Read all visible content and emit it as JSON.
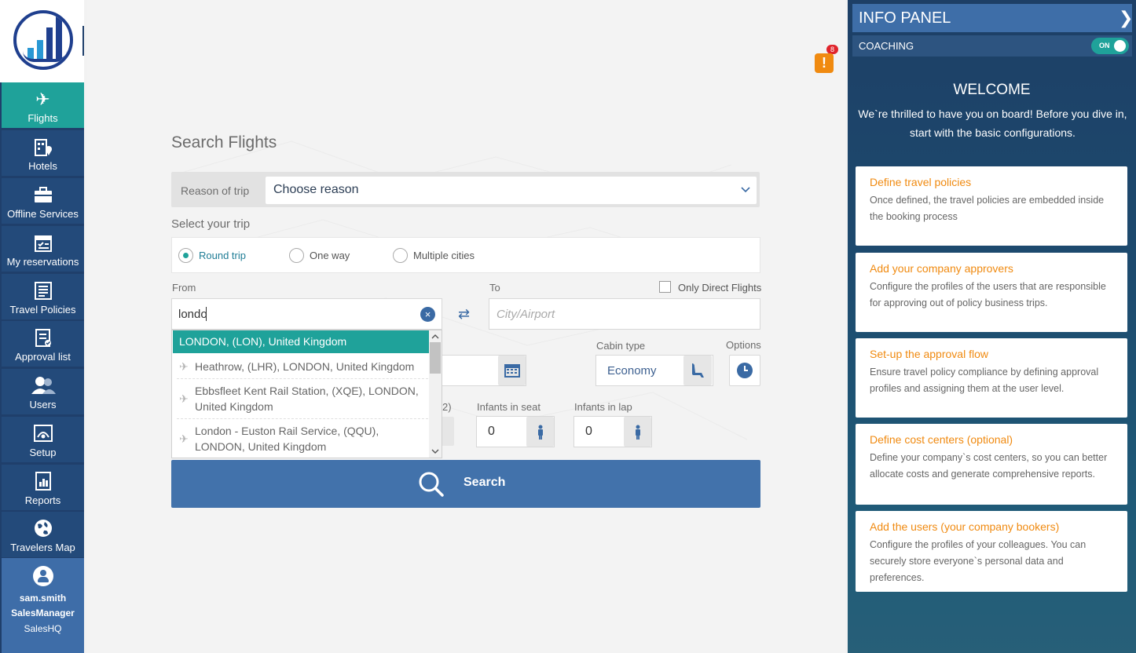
{
  "sidebar": {
    "items": [
      {
        "label": "Flights",
        "icon": "plane-icon"
      },
      {
        "label": "Hotels",
        "icon": "hotel-icon"
      },
      {
        "label": "Offline Services",
        "icon": "briefcase-icon"
      },
      {
        "label": "My reservations",
        "icon": "calendar-icon"
      },
      {
        "label": "Travel Policies",
        "icon": "document-icon"
      },
      {
        "label": "Approval list",
        "icon": "checklist-icon"
      },
      {
        "label": "Users",
        "icon": "users-icon"
      },
      {
        "label": "Setup",
        "icon": "setup-icon"
      },
      {
        "label": "Reports",
        "icon": "reports-icon"
      },
      {
        "label": "Travelers Map",
        "icon": "globe-icon"
      }
    ],
    "user": {
      "name": "sam.smith",
      "role": "SalesManager",
      "org": "SalesHQ"
    }
  },
  "alert": {
    "count": "8",
    "glyph": "!"
  },
  "search": {
    "title": "Search Flights",
    "reason_label": "Reason of trip",
    "reason_value": "Choose reason",
    "select_trip_label": "Select your trip",
    "trip_types": [
      "Round trip",
      "One way",
      "Multiple cities"
    ],
    "from_label": "From",
    "from_value": "londo",
    "to_label": "To",
    "to_placeholder": "City/Airport",
    "direct_label": "Only Direct Flights",
    "cabin_label": "Cabin type",
    "cabin_value": "Economy",
    "options_label": "Options",
    "partial_label": "2)",
    "infants_seat_label": "Infants in seat",
    "infants_seat_value": "0",
    "infants_lap_label": "Infants in lap",
    "infants_lap_value": "0",
    "button_label": "Search"
  },
  "dropdown": {
    "items": [
      "LONDON, (LON), United Kingdom",
      "Heathrow, (LHR), LONDON, United Kingdom",
      "Ebbsfleet Kent Rail Station, (XQE), LONDON, United Kingdom",
      "London - Euston Rail Service, (QQU), LONDON, United Kingdom"
    ]
  },
  "info_panel": {
    "title": "INFO PANEL",
    "coaching_label": "COACHING",
    "coaching_toggle": "ON",
    "welcome_title": "WELCOME",
    "welcome_text": "We`re thrilled to have you on board! Before you dive in, start with the basic configurations.",
    "cards": [
      {
        "title": "Define travel policies",
        "desc": "Once defined, the travel policies are embedded inside the booking process"
      },
      {
        "title": "Add your company approvers",
        "desc": "Configure the profiles of the users that are responsible for approving out of policy business trips."
      },
      {
        "title": "Set-up the approval flow",
        "desc": "Ensure travel policy compliance by defining approval profiles and assigning them at the user level."
      },
      {
        "title": "Define cost centers (optional)",
        "desc": "Define your company`s cost centers, so you can better allocate costs and generate comprehensive reports."
      },
      {
        "title": "Add the users (your company bookers)",
        "desc": "Configure the profiles of your colleagues. You can securely store everyone`s personal data and preferences."
      }
    ]
  },
  "colors": {
    "accent": "#1fa29a",
    "primary": "#4272ab",
    "sidebar": "#234a7a",
    "orange": "#f08a10"
  }
}
